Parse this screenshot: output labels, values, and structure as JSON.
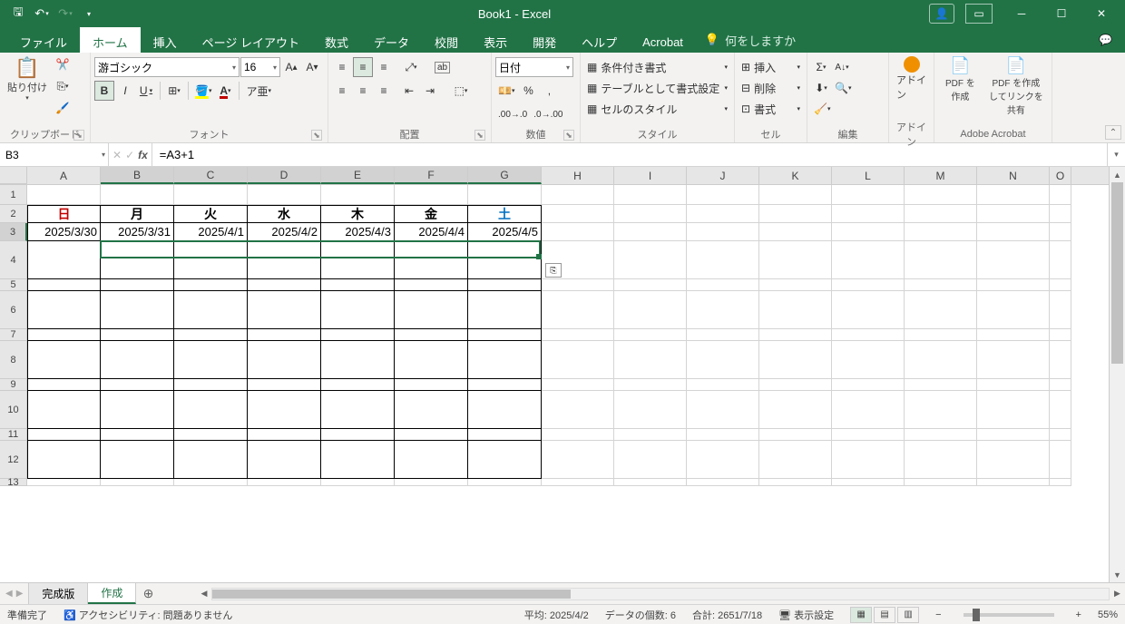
{
  "app": {
    "title": "Book1 - Excel"
  },
  "qat": {
    "save": "💾",
    "undo": "↶",
    "redo": "↷"
  },
  "tabs": {
    "file": "ファイル",
    "home": "ホーム",
    "insert": "挿入",
    "page_layout": "ページ レイアウト",
    "formulas": "数式",
    "data": "データ",
    "review": "校閲",
    "view": "表示",
    "developer": "開発",
    "help": "ヘルプ",
    "acrobat": "Acrobat",
    "tell_me": "何をしますか"
  },
  "ribbon": {
    "clipboard": {
      "paste": "貼り付け",
      "label": "クリップボード"
    },
    "font": {
      "name": "游ゴシック",
      "size": "16",
      "label": "フォント",
      "bold": "B",
      "italic": "I",
      "underline": "U"
    },
    "alignment": {
      "wrap": "ab",
      "merge": "⬚",
      "label": "配置"
    },
    "number": {
      "format": "日付",
      "label": "数値"
    },
    "styles": {
      "conditional": "条件付き書式",
      "table": "テーブルとして書式設定",
      "cell_styles": "セルのスタイル",
      "label": "スタイル"
    },
    "cells": {
      "insert": "挿入",
      "delete": "削除",
      "format": "書式",
      "label": "セル"
    },
    "editing": {
      "label": "編集"
    },
    "addins": {
      "addin": "アドイン",
      "label": "アドイン"
    },
    "acrobat": {
      "create": "PDF を作成",
      "share": "PDF を作成してリンクを共有",
      "label": "Adobe Acrobat"
    }
  },
  "formula_bar": {
    "name_box": "B3",
    "formula": "=A3+1"
  },
  "columns": [
    "A",
    "B",
    "C",
    "D",
    "E",
    "F",
    "G",
    "H",
    "I",
    "J",
    "K",
    "L",
    "M",
    "N",
    "O"
  ],
  "selected_cols": [
    "B",
    "C",
    "D",
    "E",
    "F",
    "G"
  ],
  "selected_row": 3,
  "calendar": {
    "day_headers": [
      "日",
      "月",
      "火",
      "水",
      "木",
      "金",
      "土"
    ],
    "dates": [
      "2025/3/30",
      "2025/3/31",
      "2025/4/1",
      "2025/4/2",
      "2025/4/3",
      "2025/4/4",
      "2025/4/5"
    ]
  },
  "row_heights": {
    "1": 22,
    "2": 20,
    "3": 20,
    "4": 42,
    "5": 13,
    "6": 42,
    "7": 13,
    "8": 42,
    "9": 13,
    "10": 42,
    "11": 13,
    "12": 42,
    "13": 8
  },
  "sheets": {
    "tab1": "完成版",
    "tab2": "作成"
  },
  "status": {
    "ready": "準備完了",
    "accessibility": "アクセシビリティ: 問題ありません",
    "avg_label": "平均:",
    "avg": "2025/4/2",
    "count_label": "データの個数:",
    "count": "6",
    "sum_label": "合計:",
    "sum": "2651/7/18",
    "display_settings": "表示設定",
    "zoom": "55%"
  }
}
